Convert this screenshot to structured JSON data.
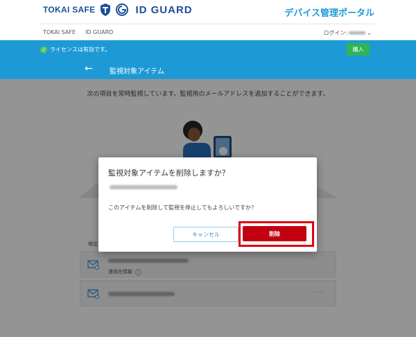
{
  "header": {
    "brand_tokai": "TOKAI SAFE",
    "brand_idguard": "ID GUARD",
    "portal_title": "デバイス管理ポータル"
  },
  "nav": {
    "link1": "TOKAI SAFE",
    "link2": "ID GUARD",
    "login_label": "ログイン:",
    "dropdown_glyph": "⌄"
  },
  "license": {
    "status_text": "ライセンスは有効です。",
    "buy_label": "購入"
  },
  "page": {
    "back_glyph": "←",
    "title": "監視対象アイテム",
    "description": "次の項目を常時監視しています。監視用のメールアドレスを追加することができます。",
    "confirm_label": "確認"
  },
  "items": [
    {
      "contact_label": "連絡先情報",
      "info_glyph": "i"
    },
    {
      "more_glyph": "···"
    }
  ],
  "modal": {
    "title": "監視対象アイテムを削除しますか？",
    "message": "このアイテムを削除して監視を停止してもよろしいですか？",
    "cancel_label": "キャンセル",
    "delete_label": "削除"
  },
  "colors": {
    "brand_blue": "#1d9ad6",
    "buy_green": "#2fb457",
    "delete_red": "#c20010",
    "highlight_red": "#e00010"
  }
}
